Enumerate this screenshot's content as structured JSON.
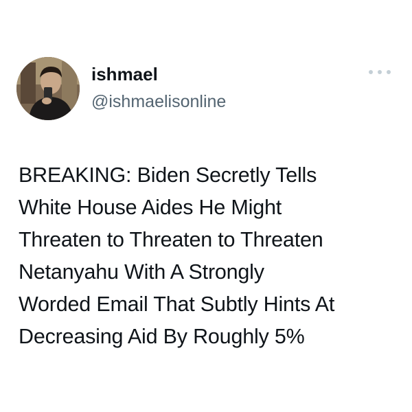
{
  "tweet": {
    "author": {
      "display_name": "ishmael",
      "handle": "@ishmaelisonline"
    },
    "more_icon": "more-horizontal-icon",
    "text_lines": [
      "BREAKING: Biden Secretly Tells",
      "White House Aides He Might",
      "Threaten to Threaten to Threaten",
      "Netanyahu With A Strongly",
      "Worded Email That Subtly Hints At",
      "Decreasing Aid By Roughly 5%"
    ]
  },
  "colors": {
    "text": "#0f1419",
    "secondary_text": "#536471",
    "icon": "#c4cfd6",
    "background": "#ffffff"
  }
}
